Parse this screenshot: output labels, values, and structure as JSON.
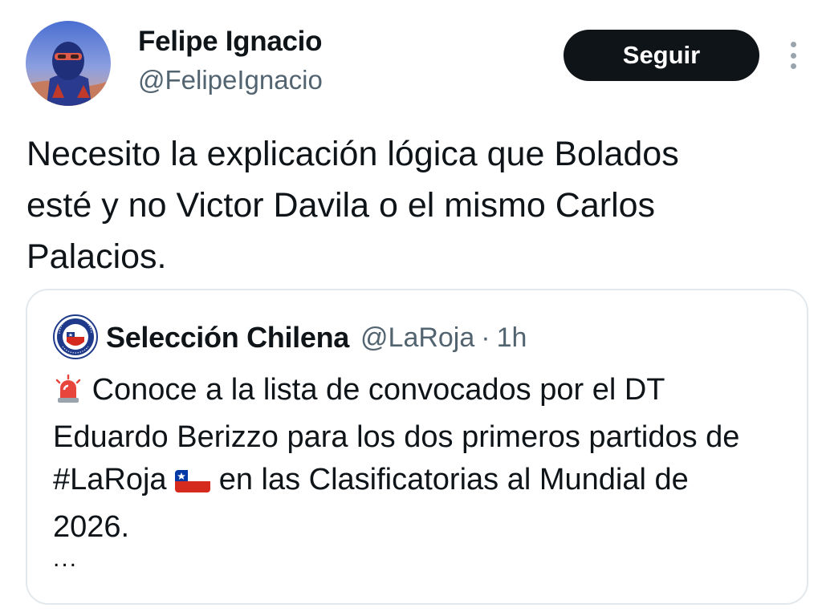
{
  "author": {
    "display_name": "Felipe Ignacio",
    "handle": "@FelipeIgnacio",
    "avatar_icon": "profile-photo"
  },
  "actions": {
    "follow_label": "Seguir",
    "more_icon": "more-vertical-icon"
  },
  "tweet": {
    "text_line1": "Necesito la explicación lógica que Bolados",
    "text_line2": "esté y no Victor Davila o el mismo Carlos",
    "text_line3": "Palacios."
  },
  "quoted_tweet": {
    "avatar_icon": "federacion-futbol-chile-crest",
    "display_name": "Selección Chilena",
    "handle": "@LaRoja",
    "separator": "·",
    "time": "1h",
    "text_part1": "Conoce a la lista de convocados por el DT",
    "text_part2": "Eduardo Berizzo para los dos primeros partidos de",
    "text_part3": "#LaRoja",
    "text_part4": "en las Clasificatorias al Mundial de",
    "text_part5": "2026.",
    "ellipsis": "...",
    "emoji_siren": "rotating-light-emoji",
    "emoji_flag": "chile-flag-emoji"
  },
  "colors": {
    "text_primary": "#0f1419",
    "text_secondary": "#536471",
    "border": "#e3e8ec",
    "button_bg": "#0f1419"
  }
}
